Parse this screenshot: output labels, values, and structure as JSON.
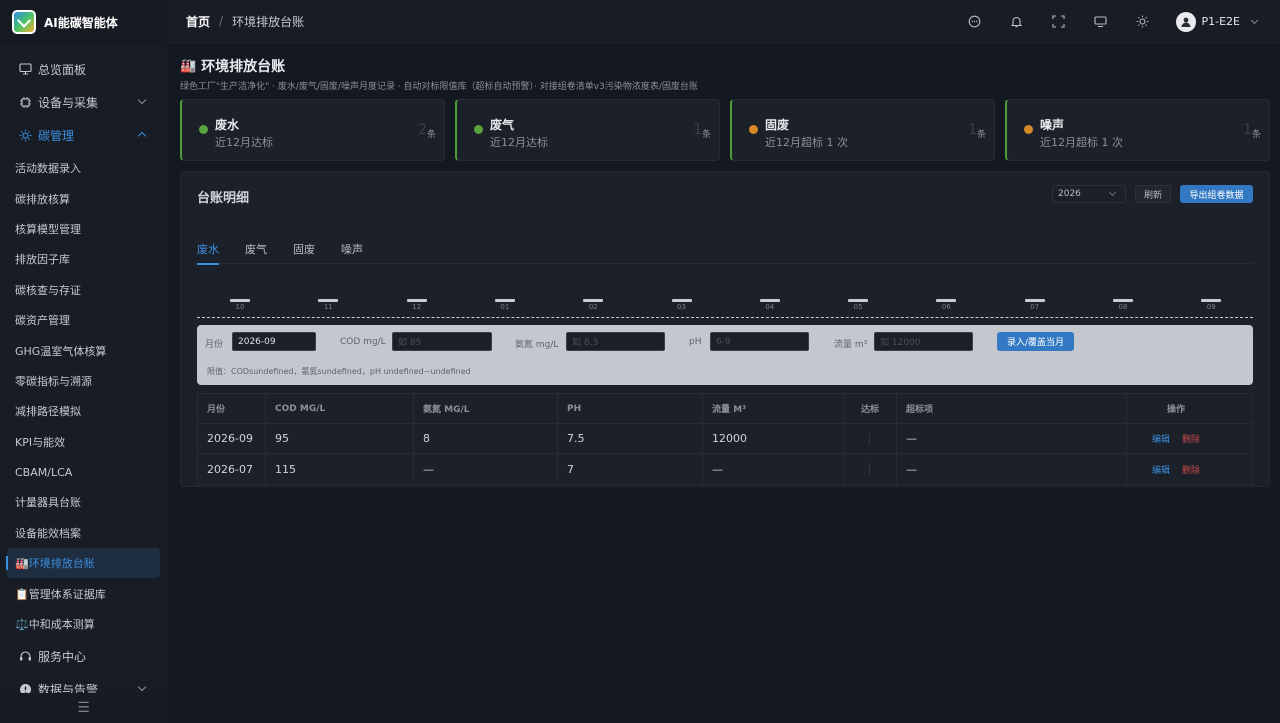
{
  "app": {
    "name": "AI能碳智能体"
  },
  "sidebar": {
    "items": [
      {
        "label": "总览面板",
        "icon": "monitor-icon"
      },
      {
        "label": "设备与采集",
        "icon": "chip-icon"
      },
      {
        "label": "碳管理",
        "icon": "sun-icon"
      }
    ],
    "subitems": [
      "活动数据录入",
      "碳排放核算",
      "核算模型管理",
      "排放因子库",
      "碳核查与存证",
      "碳资产管理",
      "GHG温室气体核算",
      "零碳指标与溯源",
      "减排路径模拟",
      "KPI与能效",
      "CBAM/LCA",
      "计量器具台账",
      "设备能效档案",
      "🏭环境排放台账",
      "📋管理体系证据库",
      "⚖️中和成本测算"
    ],
    "bottom_items": [
      {
        "label": "服务中心",
        "icon": "headset-icon"
      },
      {
        "label": "数据与告警",
        "icon": "alert-icon"
      }
    ],
    "collapse_icon": "☰"
  },
  "topbar": {
    "breadcrumb_home": "首页",
    "breadcrumb_sep": "/",
    "breadcrumb_current": "环境排放台账",
    "user": "P1-E2E"
  },
  "page": {
    "emoji": "🏭",
    "title": "环境排放台账",
    "desc": "绿色工厂\"生产洁净化\" · 废水/废气/固废/噪声月度记录 · 自动对标限值库（超标自动预警）· 对接组卷清单v3污染物浓度表/固废台账"
  },
  "stats": [
    {
      "title": "废水",
      "sub": "近12月达标",
      "num": "2",
      "unit": "条",
      "dot": "#5aa43d"
    },
    {
      "title": "废气",
      "sub": "近12月达标",
      "num": "1",
      "unit": "条",
      "dot": "#5aa43d"
    },
    {
      "title": "固废",
      "sub": "近12月超标 1 次",
      "num": "1",
      "unit": "条",
      "dot": "#d58a26"
    },
    {
      "title": "噪声",
      "sub": "近12月超标 1 次",
      "num": "1",
      "unit": "条",
      "dot": "#d58a26"
    }
  ],
  "panel": {
    "title": "台账明细",
    "year": "2026",
    "refresh": "刷新",
    "export": "导出组卷数据",
    "tabs": [
      "废水",
      "废气",
      "固废",
      "噪声"
    ],
    "months": [
      "10",
      "11",
      "12",
      "01",
      "02",
      "03",
      "04",
      "05",
      "06",
      "07",
      "08",
      "09"
    ]
  },
  "form": {
    "month_label": "月份",
    "month_value": "2026-09",
    "cod_label": "COD mg/L",
    "cod_placeholder": "如 85",
    "nh_label": "氨氮 mg/L",
    "nh_placeholder": "如 8.3",
    "ph_label": "pH",
    "ph_placeholder": "6-9",
    "flow_label": "流量 m³",
    "flow_placeholder": "如 12000",
    "submit": "录入/覆盖当月",
    "limit_text": "限值：CODsundefined，氨氮sundefined，pH undefined~undefined"
  },
  "table": {
    "headers": [
      "月份",
      "COD MG/L",
      "氨氮 MG/L",
      "PH",
      "流量 M³",
      "达标",
      "超标项",
      "操作"
    ],
    "rows": [
      {
        "month": "2026-09",
        "cod": "95",
        "nh": "8",
        "ph": "7.5",
        "flow": "12000",
        "ok": "",
        "over": "—",
        "edit": "编辑",
        "del": "删除"
      },
      {
        "month": "2026-07",
        "cod": "115",
        "nh": "—",
        "ph": "7",
        "flow": "—",
        "ok": "",
        "over": "—",
        "edit": "编辑",
        "del": "删除"
      }
    ]
  }
}
